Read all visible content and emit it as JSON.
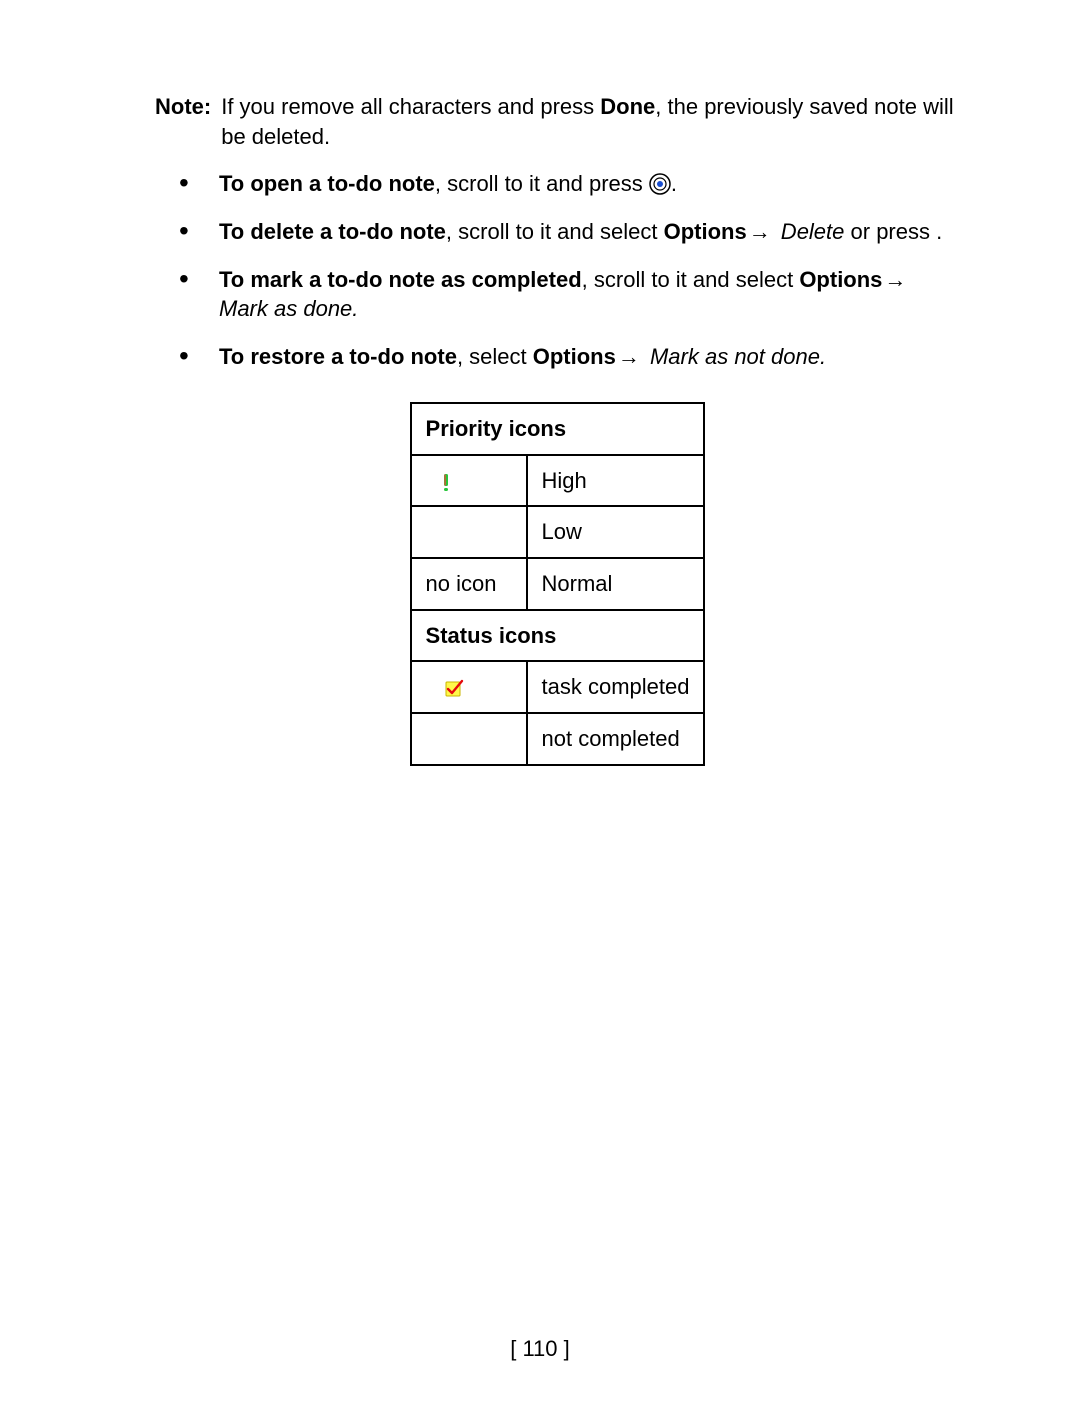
{
  "note": {
    "label": "Note:",
    "text_before_done": "If you remove all characters and press ",
    "done_word": "Done",
    "text_after_done": ", the previously saved note will be deleted."
  },
  "bullets": {
    "open": {
      "bold": "To open a to-do note",
      "rest": ", scroll to it and press ",
      "period": "."
    },
    "delete": {
      "bold": "To delete a to-do note",
      "rest1": ", scroll to it and select ",
      "options": "Options",
      "action": " Delete",
      "rest2": " or press     ."
    },
    "mark": {
      "bold": "To mark a to-do note as completed",
      "rest1": ", scroll to it and select ",
      "options": "Options",
      "action": " Mark as done."
    },
    "restore": {
      "bold": "To restore a to-do note",
      "rest1": ", select ",
      "options": "Options",
      "action": " Mark as not done."
    }
  },
  "table": {
    "header_priority": "Priority icons",
    "header_status": "Status icons",
    "rows": {
      "high_icon_text": "",
      "high_label": "High",
      "low_icon_text": "",
      "low_label": "Low",
      "normal_icon_text": "no icon",
      "normal_label": "Normal",
      "completed_label": "task completed",
      "not_completed_label": "not completed"
    }
  },
  "page_number": "[ 110 ]",
  "arrow_glyph": "→"
}
